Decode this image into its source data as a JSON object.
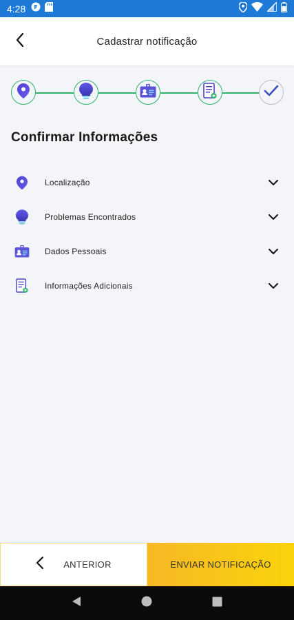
{
  "status_bar": {
    "time": "4:28",
    "left_icons": [
      "app-notification-icon",
      "sd-card-icon"
    ],
    "right_icons": [
      "location-icon",
      "wifi-icon",
      "signal-icon",
      "battery-icon"
    ],
    "color": "#1e7ad6"
  },
  "header": {
    "title": "Cadastrar notificação",
    "back_icon": "chevron-left-icon"
  },
  "stepper": {
    "steps": [
      {
        "icon": "location-pin-icon",
        "state": "completed"
      },
      {
        "icon": "lightbulb-icon",
        "state": "completed"
      },
      {
        "icon": "id-card-icon",
        "state": "completed"
      },
      {
        "icon": "document-icon",
        "state": "completed"
      },
      {
        "icon": "checkmark-icon",
        "state": "current"
      }
    ],
    "line_color": "#2fb36b"
  },
  "section": {
    "title": "Confirmar Informações"
  },
  "accordion": {
    "items": [
      {
        "label": "Localização",
        "icon": "location-pin-icon"
      },
      {
        "label": "Problemas Encontrados",
        "icon": "lightbulb-icon"
      },
      {
        "label": "Dados Pessoais",
        "icon": "id-card-icon"
      },
      {
        "label": "Informações Adicionais",
        "icon": "document-icon"
      }
    ]
  },
  "footer": {
    "previous_label": "ANTERIOR",
    "send_label": "ENVIAR NOTIFICAÇÃO",
    "accent_color": "#fbd30c"
  },
  "nav": {
    "buttons": [
      "back-triangle-icon",
      "home-circle-icon",
      "recents-square-icon"
    ]
  }
}
